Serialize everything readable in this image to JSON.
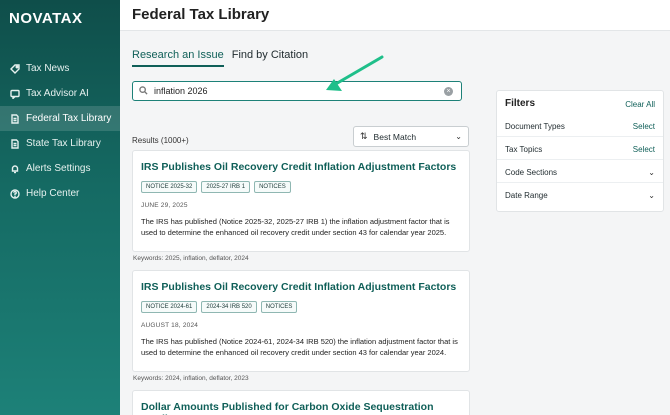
{
  "logo": "NOVATAX",
  "sidebar": {
    "items": [
      {
        "label": "Tax News",
        "icon": "tag-icon"
      },
      {
        "label": "Tax Advisor AI",
        "icon": "chat-icon"
      },
      {
        "label": "Federal Tax Library",
        "icon": "document-icon",
        "active": true
      },
      {
        "label": "State Tax Library",
        "icon": "document-icon"
      },
      {
        "label": "Alerts Settings",
        "icon": "bell-icon"
      },
      {
        "label": "Help Center",
        "icon": "help-icon"
      }
    ]
  },
  "header": {
    "title": "Federal Tax Library"
  },
  "tabs": [
    {
      "label": "Research an Issue",
      "active": true
    },
    {
      "label": "Find by Citation",
      "active": false
    }
  ],
  "search": {
    "value": "inflation 2026",
    "clear_icon": "clear-icon"
  },
  "results": {
    "count_label": "Results (1000+)",
    "sort_label": "Best Match",
    "cards": [
      {
        "title": "IRS Publishes Oil Recovery Credit Inflation Adjustment Factors",
        "tags": [
          "NOTICE 2025-32",
          "2025-27 IRB 1",
          "NOTICES"
        ],
        "date": "JUNE 29, 2025",
        "body": "The IRS has published (Notice 2025-32, 2025-27 IRB 1) the inflation adjustment factor that is used to determine the enhanced oil recovery credit under section 43 for calendar year 2025.",
        "keywords": "Keywords: 2025, inflation, deflator, 2024"
      },
      {
        "title": "IRS Publishes Oil Recovery Credit Inflation Adjustment Factors",
        "tags": [
          "NOTICE 2024-61",
          "2024-34 IRB 520",
          "NOTICES"
        ],
        "date": "AUGUST 18, 2024",
        "body": "The IRS has published (Notice 2024-61, 2024-34 IRB 520) the inflation adjustment factor that is used to determine the enhanced oil recovery credit under section 43 for calendar year 2024.",
        "keywords": "Keywords: 2024, inflation, deflator, 2023"
      },
      {
        "title": "Dollar Amounts Published for Carbon Oxide Sequestration Credit"
      }
    ]
  },
  "filters": {
    "title": "Filters",
    "clear_all": "Clear All",
    "rows": [
      {
        "label": "Document Types",
        "action": "Select"
      },
      {
        "label": "Tax Topics",
        "action": "Select"
      },
      {
        "label": "Code Sections",
        "action": "chevron"
      },
      {
        "label": "Date Range",
        "action": "chevron"
      }
    ]
  },
  "colors": {
    "accent": "#0f5f58",
    "sidebar_bg": "#156a63",
    "annotation_arrow": "#1fbf8a"
  }
}
